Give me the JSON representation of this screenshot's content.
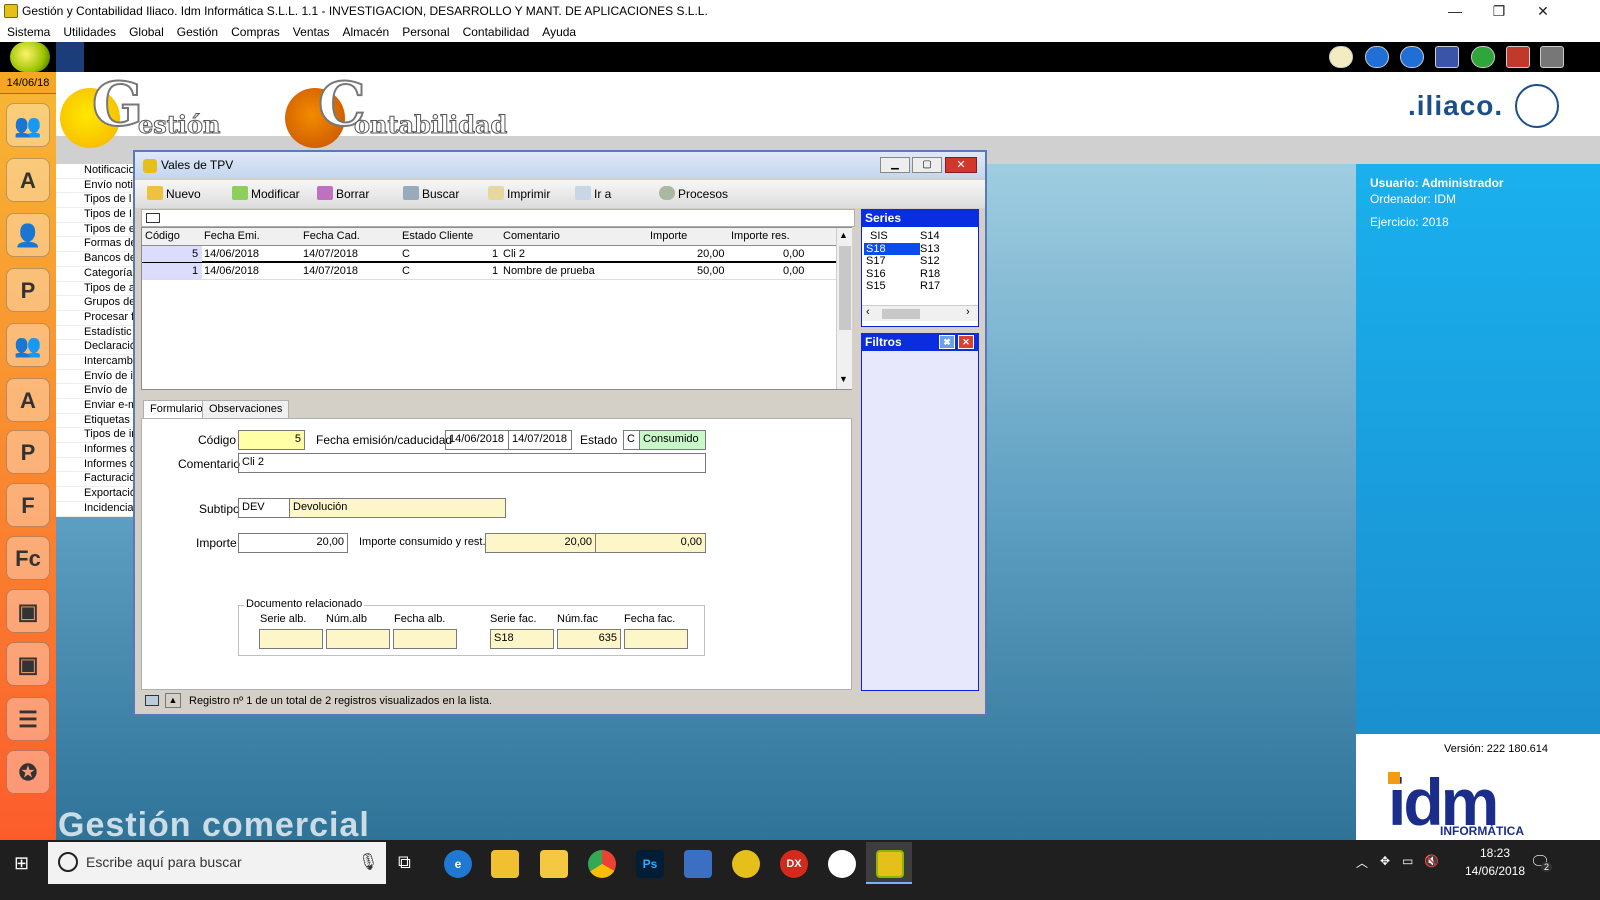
{
  "app": {
    "title": "Gestión y Contabilidad Iliaco. Idm Informática S.L.L. 1.1 - INVESTIGACION, DESARROLLO Y MANT. DE APLICACIONES S.L.L.",
    "window_controls": {
      "minimize": "—",
      "restore": "❐",
      "close": "✕"
    }
  },
  "menu": [
    "Sistema",
    "Utilidades",
    "Global",
    "Gestión",
    "Compras",
    "Ventas",
    "Almacén",
    "Personal",
    "Contabilidad",
    "Ayuda"
  ],
  "date_badge": "14/06/18",
  "left_icons": [
    "users-icon",
    "contacts-a-icon",
    "person-icon",
    "person-p-icon",
    "people-icon",
    "person-a-icon",
    "p-icon",
    "f-icon",
    "fc-icon",
    "bag-icon",
    "bag2-icon",
    "notebook-icon",
    "wand-icon"
  ],
  "left_list": [
    "Notificacio",
    "Envío noti",
    "Tipos de l",
    "Tipos de I",
    "Tipos de e",
    "Formas de",
    "Bancos de",
    "Categoría",
    "Tipos de a",
    "Grupos de",
    "Procesar f",
    "Estadístic",
    "Declaració",
    "Intercambi",
    "Envío de i",
    "Envío de",
    "Enviar e-m",
    "Etiquetas",
    "Tipos de in",
    "Informes d",
    "Informes d",
    "Facturació",
    "Exportació",
    "Incidencia"
  ],
  "logo": {
    "gestion": "estión",
    "contabilidad": "ontabilidad",
    "g": "G",
    "c": "C",
    "brand": ".iliaco."
  },
  "info": {
    "usuario": "Usuario: Administrador",
    "ordenador": "Ordenador: IDM",
    "ejercicio": "Ejercicio: 2018",
    "version": "Versión: 222 180.614",
    "idm": "idm",
    "informatica": "INFORMÁTICA"
  },
  "watermark": "Gestión comercial",
  "window": {
    "title": "Vales de TPV",
    "toolbar": [
      "Nuevo",
      "Modificar",
      "Borrar",
      "Buscar",
      "Imprimir",
      "Ir a",
      "Procesos"
    ],
    "grid": {
      "columns": [
        "Código",
        "Fecha Emi.",
        "Fecha Cad.",
        "Estado",
        "Cliente",
        "Comentario",
        "Importe",
        "Importe res."
      ],
      "rows": [
        [
          "5",
          "14/06/2018",
          "14/07/2018",
          "C",
          "1",
          "Cli 2",
          "20,00",
          "0,00"
        ],
        [
          "1",
          "14/06/2018",
          "14/07/2018",
          "C",
          "1",
          "Nombre de prueba",
          "50,00",
          "0,00"
        ]
      ]
    },
    "tabs": [
      "Formulario",
      "Observaciones"
    ],
    "form": {
      "codigo_label": "Código",
      "codigo": "5",
      "fechas_label": "Fecha emisión/caducidad",
      "fecha_emi": "14/06/2018",
      "fecha_cad": "14/07/2018",
      "estado_label": "Estado",
      "estado_code": "C",
      "estado_text": "Consumido",
      "comentario_label": "Comentario",
      "comentario": "Cli 2",
      "subtipo_label": "Subtipo",
      "subtipo_code": "DEV",
      "subtipo_text": "Devolución",
      "importe_label": "Importe",
      "importe": "20,00",
      "consumido_label": "Importe consumido y rest.",
      "consumido": "20,00",
      "restante": "0,00",
      "doc_group": "Documento relacionado",
      "serie_alb_label": "Serie alb.",
      "num_alb_label": "Núm.alb",
      "fecha_alb_label": "Fecha alb.",
      "serie_fac_label": "Serie fac.",
      "num_fac_label": "Núm.fac",
      "fecha_fac_label": "Fecha fac.",
      "serie_alb": "",
      "num_alb": "",
      "fecha_alb": "",
      "serie_fac": "S18",
      "num_fac": "635",
      "fecha_fac": ""
    },
    "status": "Registro nº 1 de un total de 2 registros visualizados en la lista.",
    "series_title": "Series",
    "series_col1": [
      "SIS",
      "S18",
      "S17",
      "S16",
      "S15"
    ],
    "series_col2": [
      "S14",
      "S13",
      "S12",
      "R18",
      "R17"
    ],
    "series_selected": "S18",
    "filtros_title": "Filtros"
  },
  "taskbar": {
    "search_placeholder": "Escribe aquí para buscar",
    "time": "18:23",
    "date": "14/06/2018",
    "notif_count": "2"
  },
  "colors": {
    "accent": "#0a2de0",
    "left_bar": "#f7b733",
    "right_panel": "#1aa5e3",
    "selected_row": "#dcdcff"
  }
}
